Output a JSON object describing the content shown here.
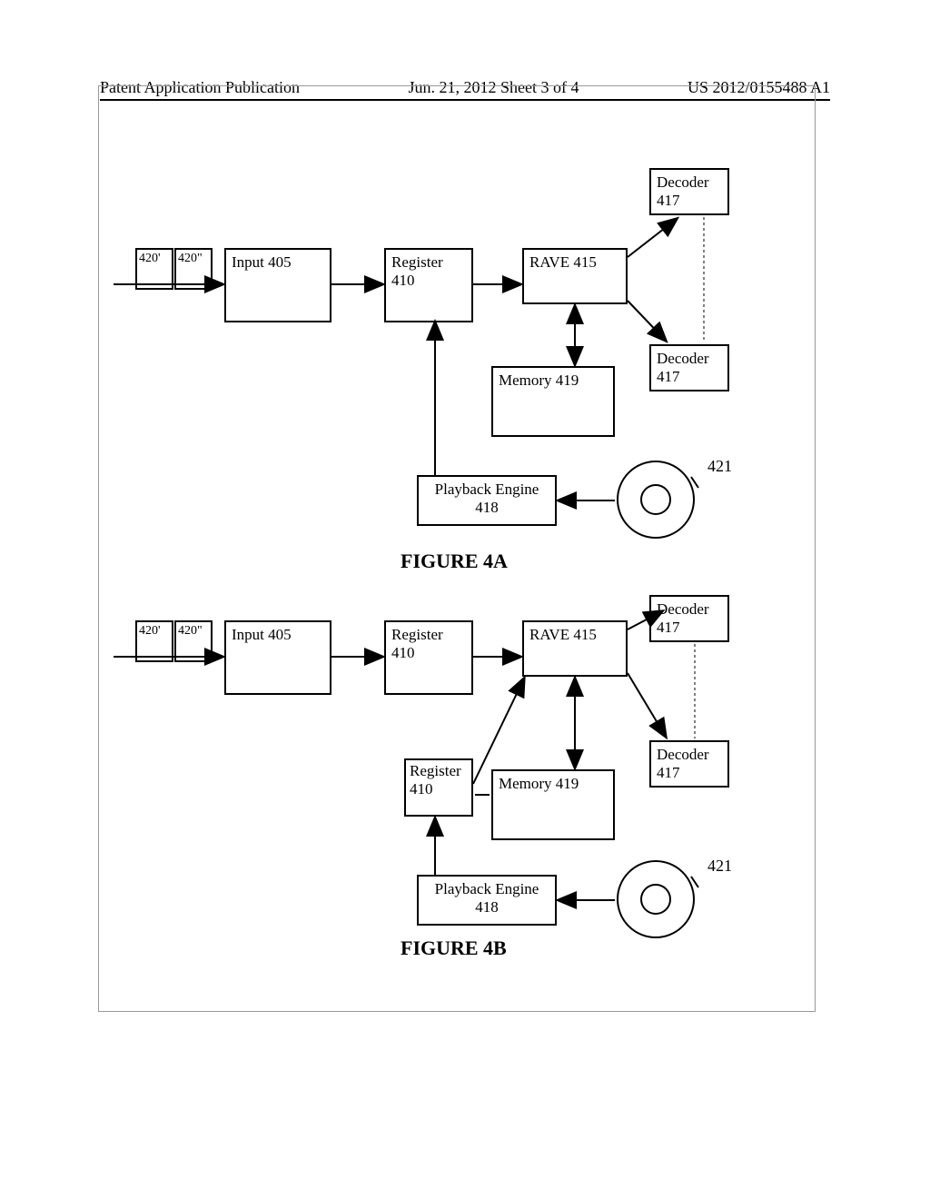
{
  "header": {
    "left": "Patent Application Publication",
    "center": "Jun. 21, 2012  Sheet 3 of 4",
    "right": "US 2012/0155488 A1"
  },
  "figA": {
    "title": "FIGURE 4A",
    "packet1": "420'",
    "packet2": "420\"",
    "input": "Input 405",
    "register": "Register 410",
    "rave": "RAVE 415",
    "decoder_top": "Decoder 417",
    "decoder_bottom": "Decoder 417",
    "memory": "Memory 419",
    "playback": "Playback Engine 418",
    "disc_ref": "421"
  },
  "figB": {
    "title": "FIGURE 4B",
    "packet1": "420'",
    "packet2": "420\"",
    "input": "Input 405",
    "register_main": "Register 410",
    "register_sec": "Register 410",
    "rave": "RAVE 415",
    "decoder_top": "Decoder 417",
    "decoder_bottom": "Decoder 417",
    "memory": "Memory 419",
    "playback": "Playback Engine 418",
    "disc_ref": "421"
  }
}
